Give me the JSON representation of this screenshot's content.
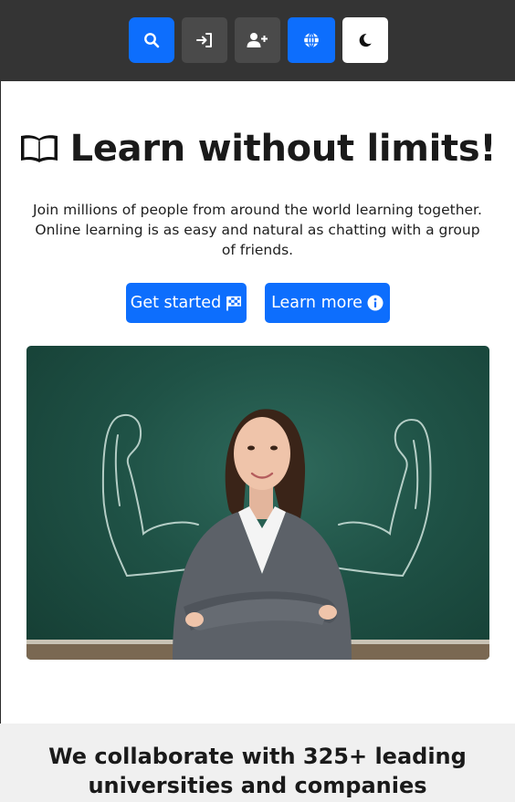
{
  "navbar": {
    "buttons": [
      {
        "icon": "search-icon",
        "color": "#0d6efd"
      },
      {
        "icon": "login-icon",
        "color": "#4a4a4a"
      },
      {
        "icon": "add-user-icon",
        "color": "#4a4a4a"
      },
      {
        "icon": "globe-icon",
        "color": "#0d6efd"
      },
      {
        "icon": "moon-icon",
        "color": "#ffffff"
      }
    ]
  },
  "hero": {
    "title": "Learn without limits!",
    "title_icon": "open-book-icon",
    "lead": "Join millions of people from around the world learning together. Online learning is as easy and natural as chatting with a group of friends.",
    "primary_cta": {
      "label": "Get started",
      "icon": "checkered-flag-icon"
    },
    "secondary_cta": {
      "label": "Learn more",
      "icon": "info-circle-icon"
    },
    "image": "teacher-at-chalkboard-photo"
  },
  "partners": {
    "title": "We collaborate with 325+ leading universities and companies"
  },
  "colors": {
    "primary": "#0d6efd",
    "navbar_bg": "#343434",
    "section_bg": "#f0f0f0"
  }
}
